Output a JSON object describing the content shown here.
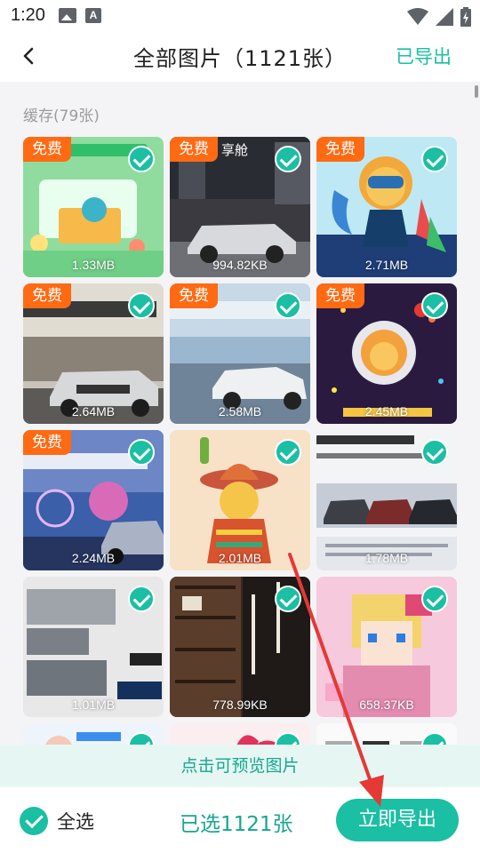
{
  "status_bar": {
    "time": "1:20",
    "icons": [
      "image-notification-icon",
      "text-notification-icon",
      "wifi-icon",
      "signal-icon",
      "battery-charging-icon"
    ]
  },
  "header": {
    "title": "全部图片（1121张）",
    "action_label": "已导出"
  },
  "section": {
    "title": "缓存(79张)"
  },
  "badge_label": "免费",
  "tiles": [
    {
      "size": "1.33MB",
      "free": true,
      "selected": true,
      "subject": "green-promo-illustration"
    },
    {
      "size": "994.82KB",
      "free": true,
      "selected": true,
      "subject": "car-photo",
      "caption": "享舱"
    },
    {
      "size": "2.71MB",
      "free": true,
      "selected": true,
      "subject": "lion-diver-cartoon"
    },
    {
      "size": "2.64MB",
      "free": true,
      "selected": true,
      "subject": "car-billboard"
    },
    {
      "size": "2.58MB",
      "free": true,
      "selected": true,
      "subject": "white-car-ad"
    },
    {
      "size": "2.45MB",
      "free": true,
      "selected": true,
      "subject": "lion-astronaut-cartoon"
    },
    {
      "size": "2.24MB",
      "free": true,
      "selected": true,
      "subject": "night-car-ad"
    },
    {
      "size": "2.01MB",
      "free": false,
      "selected": true,
      "subject": "lion-sombrero-cartoon"
    },
    {
      "size": "1.78MB",
      "free": false,
      "selected": true,
      "subject": "car-lineup-flyer"
    },
    {
      "size": "1.01MB",
      "free": false,
      "selected": true,
      "subject": "car-collage"
    },
    {
      "size": "778.99KB",
      "free": false,
      "selected": true,
      "subject": "bookshelf-poster"
    },
    {
      "size": "658.37KB",
      "free": false,
      "selected": true,
      "subject": "pixel-art-girl"
    },
    {
      "size": "",
      "free": false,
      "selected": true,
      "subject": "partial-tile"
    },
    {
      "size": "",
      "free": false,
      "selected": true,
      "subject": "partial-tile"
    },
    {
      "size": "",
      "free": false,
      "selected": true,
      "subject": "partial-tile"
    }
  ],
  "preview_hint": "点击可预览图片",
  "bottom_bar": {
    "select_all_label": "全选",
    "selected_count_label": "已选1121张",
    "export_button_label": "立即导出"
  },
  "colors": {
    "accent": "#1bbfa3",
    "badge": "#ff6a13",
    "hint_bg": "#e6f7f3",
    "annotation": "#e53935"
  }
}
